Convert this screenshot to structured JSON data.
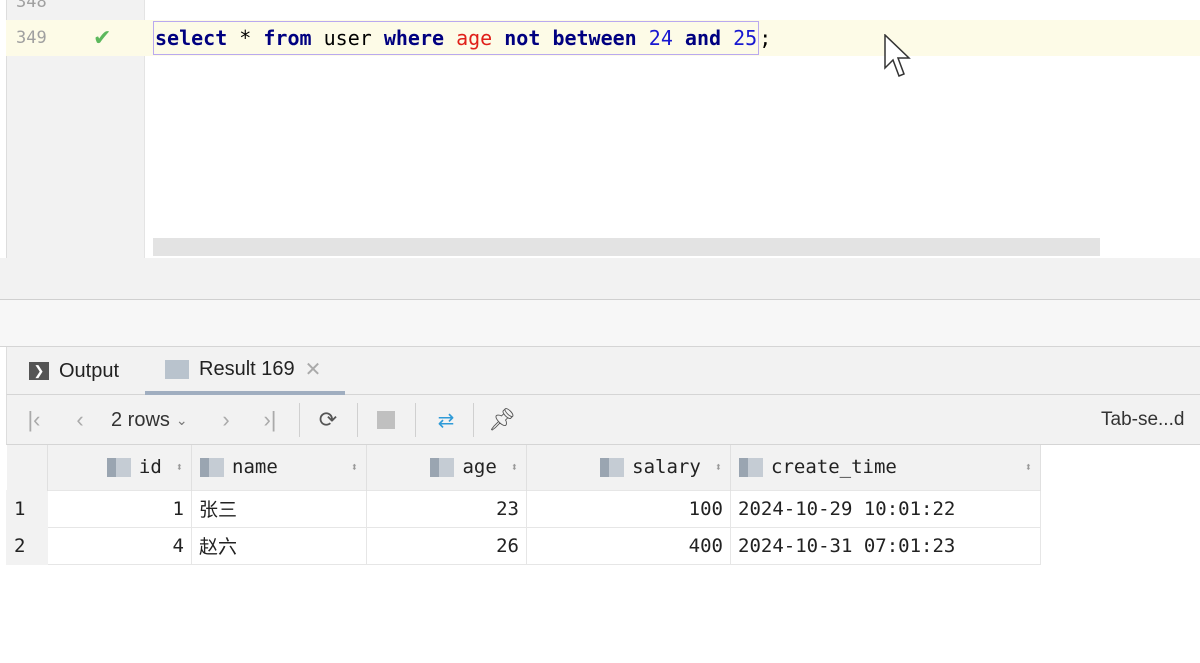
{
  "editor": {
    "lines": [
      {
        "number": "348"
      },
      {
        "number": "349",
        "status": "check-icon"
      }
    ],
    "code_tokens": [
      {
        "t": "select",
        "c": "kw"
      },
      {
        "t": " ",
        "c": "op"
      },
      {
        "t": "*",
        "c": "op"
      },
      {
        "t": " ",
        "c": "op"
      },
      {
        "t": "from",
        "c": "kw"
      },
      {
        "t": " ",
        "c": "op"
      },
      {
        "t": "user",
        "c": "id"
      },
      {
        "t": " ",
        "c": "op"
      },
      {
        "t": "where",
        "c": "kw"
      },
      {
        "t": " ",
        "c": "op"
      },
      {
        "t": "age",
        "c": "col"
      },
      {
        "t": " ",
        "c": "op"
      },
      {
        "t": "not",
        "c": "kw"
      },
      {
        "t": " ",
        "c": "op"
      },
      {
        "t": "between",
        "c": "kw"
      },
      {
        "t": " ",
        "c": "op"
      },
      {
        "t": "24",
        "c": "num"
      },
      {
        "t": " ",
        "c": "op"
      },
      {
        "t": "and",
        "c": "kw"
      },
      {
        "t": " ",
        "c": "op"
      },
      {
        "t": "25",
        "c": "num"
      }
    ],
    "code_suffix": ";"
  },
  "tabs": {
    "output": "Output",
    "result": "Result 169"
  },
  "toolbar": {
    "rows": "2 rows",
    "right_label": "Tab-se...d"
  },
  "table": {
    "columns": [
      "id",
      "name",
      "age",
      "salary",
      "create_time"
    ],
    "rows": [
      {
        "n": "1",
        "id": "1",
        "name": "张三",
        "age": "23",
        "salary": "100",
        "create_time": "2024-10-29 10:01:22"
      },
      {
        "n": "2",
        "id": "4",
        "name": "赵六",
        "age": "26",
        "salary": "400",
        "create_time": "2024-10-31 07:01:23"
      }
    ]
  }
}
